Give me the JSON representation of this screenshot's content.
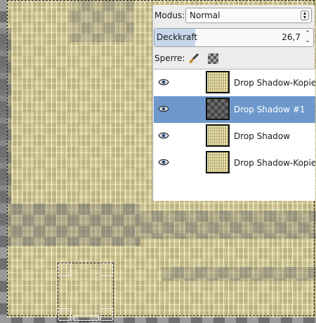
{
  "layers_panel": {
    "mode_label": "Modus:",
    "mode_value": "Normal",
    "opacity_label": "Deckkraft",
    "opacity_value": "26,7",
    "lock_label": "Sperre:",
    "layers": [
      {
        "name": "Drop Shadow-Kopie #",
        "visible": true,
        "selected": false,
        "thumb": "texture"
      },
      {
        "name": "Drop Shadow #1",
        "visible": true,
        "selected": true,
        "thumb": "checker"
      },
      {
        "name": "Drop Shadow",
        "visible": true,
        "selected": false,
        "thumb": "texture"
      },
      {
        "name": "Drop Shadow-Kopie #",
        "visible": true,
        "selected": false,
        "thumb": "texture"
      }
    ],
    "icons": {
      "visibility": "eye-icon",
      "lock_pixels": "paintbrush-icon",
      "lock_alpha": "checker-icon",
      "mode_dropdown": "up-down-arrows-icon"
    }
  },
  "colors": {
    "selection_highlight": "#6e98cc",
    "opacity_fill": "#c6d7ec",
    "canvas_texture": "#e2d696",
    "transparency_dark": "#6f6f6f"
  }
}
